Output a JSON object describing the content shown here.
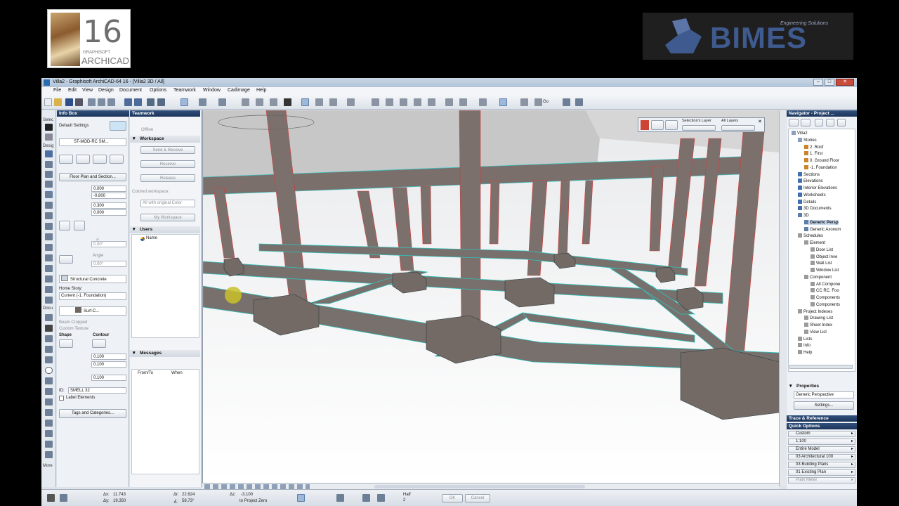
{
  "branding": {
    "archicad_version": "16",
    "archicad_company": "GRAPHISOFT",
    "archicad_product": "ARCHICAD",
    "partner_name": "BIMES",
    "partner_tagline": "Engineering Solutions"
  },
  "window": {
    "title": "Villa2 - Graphisoft ArchiCAD-64 16 - [Villa2 3D / All]"
  },
  "menu": [
    "File",
    "Edit",
    "View",
    "Design",
    "Document",
    "Options",
    "Teamwork",
    "Window",
    "Cadimage",
    "Help"
  ],
  "toolbar": {
    "go_label": "Go"
  },
  "toolbox": {
    "select_label": "Selec",
    "design_label": "Desig",
    "docu_label": "Docu",
    "more_label": "More"
  },
  "infobox": {
    "title": "Info Box",
    "default_settings": "Default Settings",
    "profile_name": "ST-MOD-RC SM...",
    "floor_plan_section": "Floor Plan and Section...",
    "val_e": "0.000",
    "val_b": "-0.800",
    "val_w": "0.300",
    "val_h": "0.000",
    "angle1": "0.00°",
    "angle_label": "Angle",
    "angle2": "0.00°",
    "material": "Structural Concrete",
    "home_story_label": "Home Story:",
    "home_story": "Current (-1. Foundation)",
    "surface": "Surf-C...",
    "beam_cropped": "Beam Cropped",
    "custom_texture": "Custom Texture",
    "shape_label": "Shape",
    "contour_label": "Contour",
    "shape_w": "0.100",
    "shape_h": "0.100",
    "shape_d": "0.100",
    "id_label": "ID:",
    "id_value": "SMELL 32",
    "label_elements": "Label Elements",
    "tags_button": "Tags and Categories..."
  },
  "teamwork": {
    "title": "Teamwork",
    "offline": "Offline",
    "workspace_header": "Workspace",
    "send_receive": "Send & Receive",
    "reserve": "Reserve",
    "release": "Release",
    "colored_workspace": "Colored workspace:",
    "all_original": "All with original Color",
    "my_workspace": "My Workspace",
    "users_header": "Users",
    "users_col": "Name",
    "messages_header": "Messages",
    "msg_from": "From/To",
    "msg_when": "When"
  },
  "viewport": {
    "selection_layer": "Selection's Layer",
    "all_layers": "All Layers"
  },
  "navigator": {
    "title": "Navigator - Project ...",
    "tree": [
      {
        "label": "Villa2",
        "indent": 0,
        "icon": "i-doc"
      },
      {
        "label": "Stories",
        "indent": 1,
        "icon": "i-doc"
      },
      {
        "label": "2. Roof",
        "indent": 2,
        "icon": "i-story"
      },
      {
        "label": "1. First",
        "indent": 2,
        "icon": "i-story"
      },
      {
        "label": "0. Ground Floor",
        "indent": 2,
        "icon": "i-story"
      },
      {
        "label": "-1. Foundation",
        "indent": 2,
        "icon": "i-story"
      },
      {
        "label": "Sections",
        "indent": 1,
        "icon": "i-sect"
      },
      {
        "label": "Elevations",
        "indent": 1,
        "icon": "i-sect"
      },
      {
        "label": "Interior Elevations",
        "indent": 1,
        "icon": "i-sect"
      },
      {
        "label": "Worksheets",
        "indent": 1,
        "icon": "i-sect"
      },
      {
        "label": "Details",
        "indent": 1,
        "icon": "i-sect"
      },
      {
        "label": "3D Documents",
        "indent": 1,
        "icon": "i-sect"
      },
      {
        "label": "3D",
        "indent": 1,
        "icon": "i-pers"
      },
      {
        "label": "Generic Persp",
        "indent": 2,
        "icon": "i-pers",
        "selected": true
      },
      {
        "label": "Generic Axonom",
        "indent": 2,
        "icon": "i-pers"
      },
      {
        "label": "Schedules",
        "indent": 1,
        "icon": "i-list"
      },
      {
        "label": "Element",
        "indent": 2,
        "icon": "i-list"
      },
      {
        "label": "Door List",
        "indent": 3,
        "icon": "i-list"
      },
      {
        "label": "Object Inve",
        "indent": 3,
        "icon": "i-list"
      },
      {
        "label": "Wall List",
        "indent": 3,
        "icon": "i-list"
      },
      {
        "label": "Window List",
        "indent": 3,
        "icon": "i-list"
      },
      {
        "label": "Component",
        "indent": 2,
        "icon": "i-list"
      },
      {
        "label": "All Compone",
        "indent": 3,
        "icon": "i-list"
      },
      {
        "label": "CC RC. Foo",
        "indent": 3,
        "icon": "i-list"
      },
      {
        "label": "Components",
        "indent": 3,
        "icon": "i-list"
      },
      {
        "label": "Components",
        "indent": 3,
        "icon": "i-list"
      },
      {
        "label": "Project Indexes",
        "indent": 1,
        "icon": "i-list"
      },
      {
        "label": "Drawing List",
        "indent": 2,
        "icon": "i-list"
      },
      {
        "label": "Sheet Index",
        "indent": 2,
        "icon": "i-list"
      },
      {
        "label": "View List",
        "indent": 2,
        "icon": "i-list"
      },
      {
        "label": "Lists",
        "indent": 1,
        "icon": "i-list"
      },
      {
        "label": "Info",
        "indent": 1,
        "icon": "i-list"
      },
      {
        "label": "Help",
        "indent": 1,
        "icon": "i-list"
      }
    ],
    "properties_header": "Properties",
    "properties_value": "Generic Perspective",
    "settings_button": "Settings...",
    "trace_header": "Trace & Reference",
    "quick_options_header": "Quick Options",
    "quick_options": [
      "Custom",
      "1:100",
      "Entire Model",
      "03 Architectural 100",
      "03 Building Plans",
      "01 Existing Plan",
      "Plain Meter"
    ]
  },
  "status": {
    "dx_label": "Δx:",
    "dx": "11.743",
    "dy_label": "Δy:",
    "dy": "19.350",
    "dr_label": "Δr:",
    "dr": "22.624",
    "da_label": "∡:",
    "da": "58.73°",
    "dz_label": "Δz:",
    "dz": "-3.100",
    "ref": "to Project Zero",
    "half": "Half",
    "half_val": "2",
    "ok": "OK",
    "cancel": "Cancel"
  }
}
